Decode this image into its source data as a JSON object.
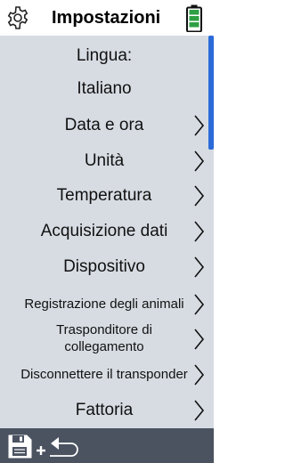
{
  "header": {
    "title": "Impostazioni",
    "gear_icon": "gear-icon",
    "battery_icon": "battery-icon",
    "battery_color": "#2ea043"
  },
  "settings": {
    "language_label": "Lingua:",
    "language_value": "Italiano",
    "items": [
      {
        "label": "Data e ora"
      },
      {
        "label": "Unità"
      },
      {
        "label": "Temperatura"
      },
      {
        "label": "Acquisizione dati"
      },
      {
        "label": "Dispositivo"
      },
      {
        "label": "Registrazione degli animali"
      },
      {
        "label_line1": "Trasponditore di",
        "label_line2": "collegamento"
      },
      {
        "label": "Disconnettere il transponder"
      },
      {
        "label": "Fattoria"
      }
    ]
  },
  "colors": {
    "panel_bg": "#d7dce3",
    "footer_bg": "#4b5361",
    "scroll_accent": "#2b6bd9"
  },
  "footer": {
    "save_icon": "save-icon",
    "plus_icon": "plus-icon",
    "back_icon": "undo-arrow-icon"
  }
}
